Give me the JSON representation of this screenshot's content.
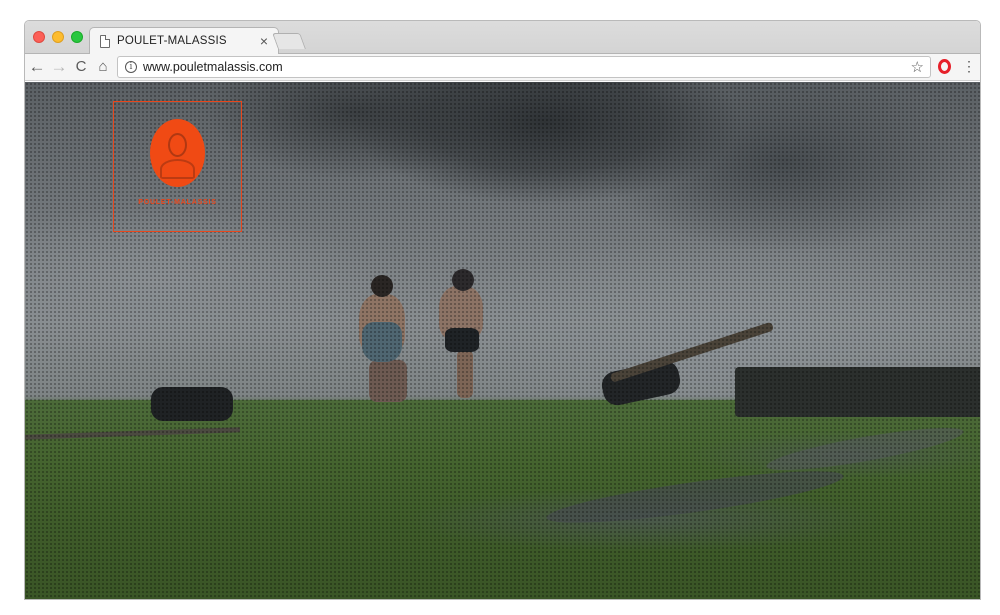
{
  "browser": {
    "tab": {
      "title": "POULET-MALASSIS",
      "close_glyph": "×"
    },
    "toolbar": {
      "back_glyph": "←",
      "forward_glyph": "→",
      "reload_glyph": "C",
      "home_glyph": "⌂",
      "url": "www.pouletmalassis.com",
      "info_glyph": "i",
      "star_glyph": "☆",
      "menu_glyph": "⋮"
    },
    "icons": {
      "site_info": "info-icon",
      "bookmark": "star-icon",
      "extension": "opera-icon",
      "menu": "kebab-menu-icon"
    }
  },
  "page": {
    "logo": {
      "caption": "POULET-MALASSIS",
      "color": "#e8471c"
    }
  }
}
